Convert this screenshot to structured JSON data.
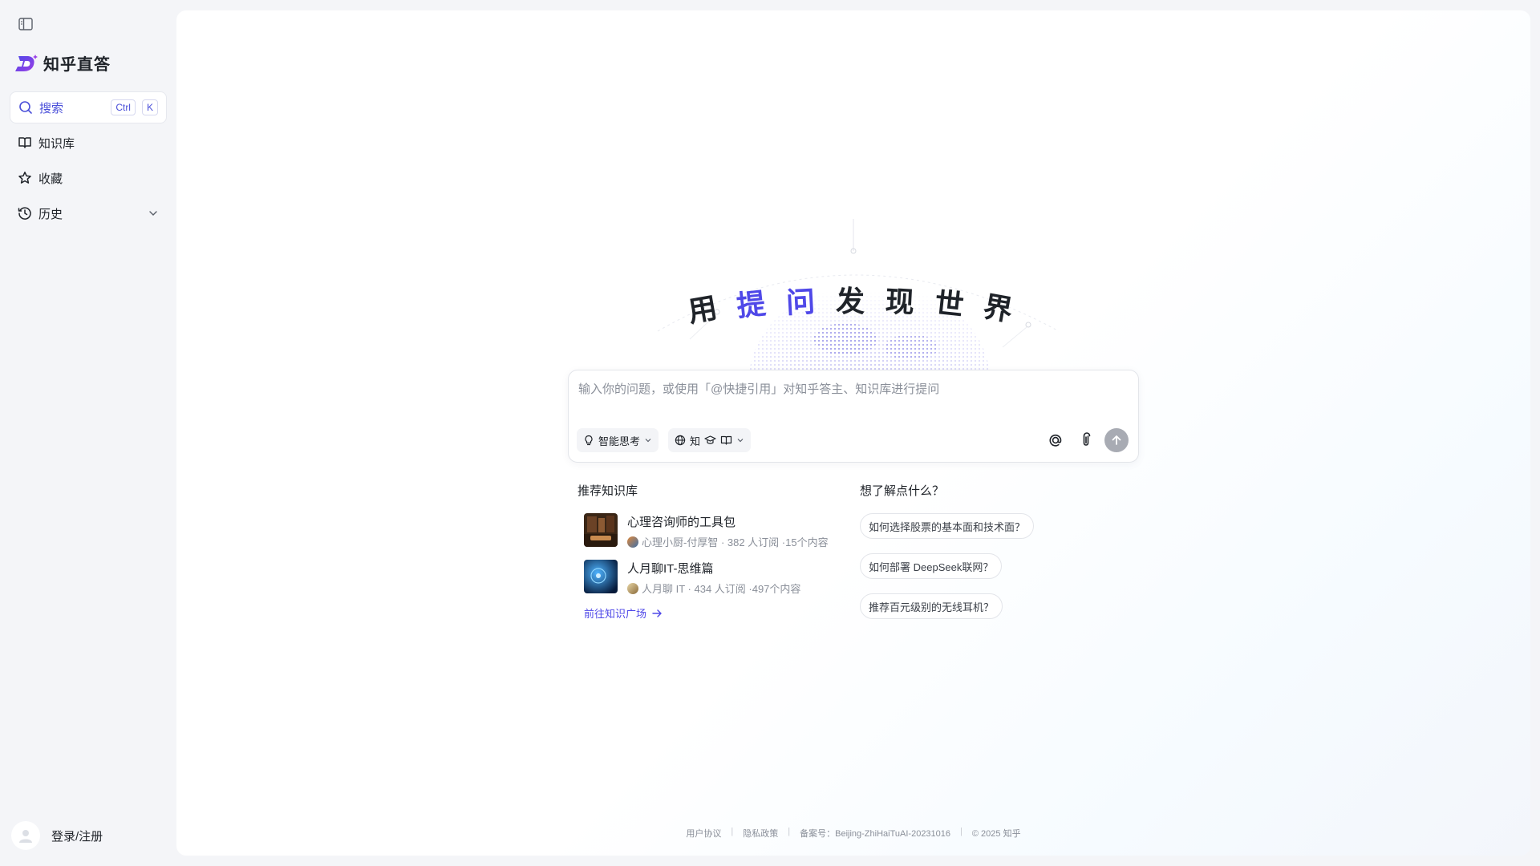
{
  "sidebar": {
    "brand_name": "知乎直答",
    "search": {
      "label": "搜索",
      "shortcut_ctrl": "Ctrl",
      "shortcut_key": "K"
    },
    "items": [
      {
        "label": "知识库",
        "icon": "book-icon"
      },
      {
        "label": "收藏",
        "icon": "star-icon"
      },
      {
        "label": "历史",
        "icon": "clock-icon"
      }
    ],
    "user_label": "登录/注册"
  },
  "hero": {
    "slogan": [
      "用",
      "提",
      "问",
      "发",
      "现",
      "世",
      "界"
    ]
  },
  "ask": {
    "placeholder": "输入你的问题，或使用「@快捷引用」对知乎答主、知识库进行提问",
    "mode_label": "智能思考",
    "source_label": "知"
  },
  "recommend": {
    "title": "推荐知识库",
    "items": [
      {
        "title": "心理咨询师的工具包",
        "meta": "心理小厨-付厚智 · 382 人订阅 ·15个内容"
      },
      {
        "title": "人月聊IT-思维篇",
        "meta": "人月聊 IT · 434 人订阅 ·497个内容"
      }
    ],
    "link": "前往知识广场"
  },
  "questions": {
    "title": "想了解点什么？",
    "items": [
      "如何选择股票的基本面和技术面？",
      "如何部署 DeepSeek联网？",
      "推荐百元级别的无线耳机？"
    ]
  },
  "footer": {
    "terms": "用户协议",
    "privacy": "隐私政策",
    "icp": "备案号：Beijing-ZhiHaiTuAI-20231016",
    "copyright": "© 2025 知乎"
  },
  "colors": {
    "accent": "#4f48e8",
    "brand": "#4a4fd9"
  }
}
